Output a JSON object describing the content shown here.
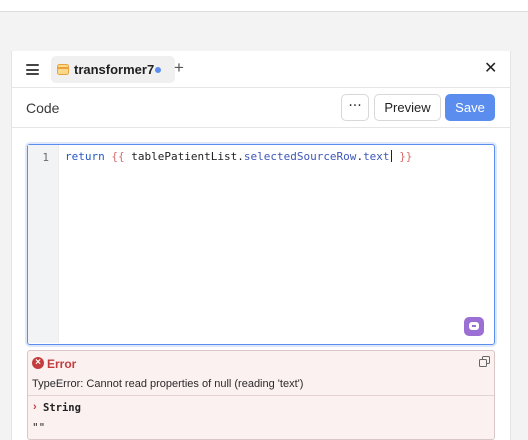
{
  "tab": {
    "label": "transformer7",
    "add_label": "+"
  },
  "header": {
    "title": "Code",
    "more_label": "···",
    "preview_label": "Preview",
    "save_label": "Save"
  },
  "editor": {
    "line_number": "1",
    "code": {
      "keyword": "return",
      "open": "{{",
      "object": "tablePatientList",
      "dot1": ".",
      "prop1": "selectedSourceRow",
      "dot2": ".",
      "prop2": "text",
      "close": "}}"
    }
  },
  "error": {
    "title": "Error",
    "message": "TypeError: Cannot read properties of null (reading 'text')",
    "type_label": "String",
    "value": "\"\""
  },
  "colors": {
    "accent": "#5b8def",
    "error": "#c43d3d",
    "ai": "#9b6fd3"
  },
  "icons": [
    "hamburger-icon",
    "query-icon",
    "unsaved-dot-icon",
    "close-icon",
    "ai-assist-icon",
    "error-icon",
    "copy-icon",
    "chevron-right-icon"
  ]
}
